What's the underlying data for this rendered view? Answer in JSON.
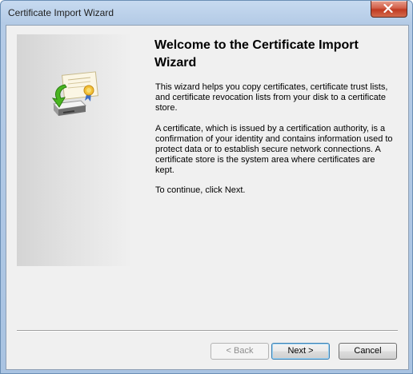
{
  "window": {
    "title": "Certificate Import Wizard"
  },
  "content": {
    "heading": "Welcome to the Certificate Import Wizard",
    "paragraphs": [
      "This wizard helps you copy certificates, certificate trust lists, and certificate revocation lists from your disk to a certificate store.",
      "A certificate, which is issued by a certification authority, is a confirmation of your identity and contains information used to protect data or to establish secure network connections. A certificate store is the system area where certificates are kept.",
      "To continue, click Next."
    ]
  },
  "buttons": {
    "back": "< Back",
    "next": "Next >",
    "cancel": "Cancel"
  },
  "icons": {
    "close": "close-icon",
    "wizard": "certificate-import-icon"
  },
  "colors": {
    "client_background": "#f0f0f0",
    "close_button": "#c03a22",
    "default_button_border": "#3c7fb1"
  }
}
